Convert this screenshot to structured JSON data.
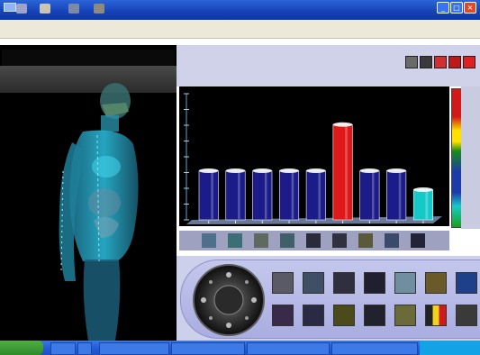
{
  "window": {
    "title": "",
    "subtitle": "",
    "buttons": {
      "minimize": "_",
      "maximize": "□",
      "close": "×"
    }
  },
  "viewer": {
    "title": "",
    "figure": "human-body-3d-scan"
  },
  "info_panel": {
    "line1": "",
    "line2": ""
  },
  "chart_data": {
    "type": "bar",
    "categories": [
      "1",
      "2",
      "3",
      "4",
      "5",
      "6",
      "7",
      "8",
      "9"
    ],
    "values": [
      7,
      7,
      7,
      7,
      7,
      13.6,
      7,
      7,
      4.3
    ],
    "colors": [
      "#1b1b8a",
      "#1b1b8a",
      "#1b1b8a",
      "#1b1b8a",
      "#1b1b8a",
      "#e01818",
      "#1b1b8a",
      "#1b1b8a",
      "#16c9c9"
    ],
    "ylim": [
      0,
      18
    ],
    "grid": false,
    "title": "",
    "xlabel": "",
    "ylabel": ""
  },
  "taskbar": {
    "start": "",
    "tasks": [
      "",
      "",
      "",
      ""
    ],
    "clock": ""
  },
  "colors": {
    "titlebar": "#1542b6",
    "panel": "#cdd0ea",
    "bar_normal": "#1b1b8a",
    "bar_high": "#e01818",
    "bar_low": "#16c9c9"
  }
}
